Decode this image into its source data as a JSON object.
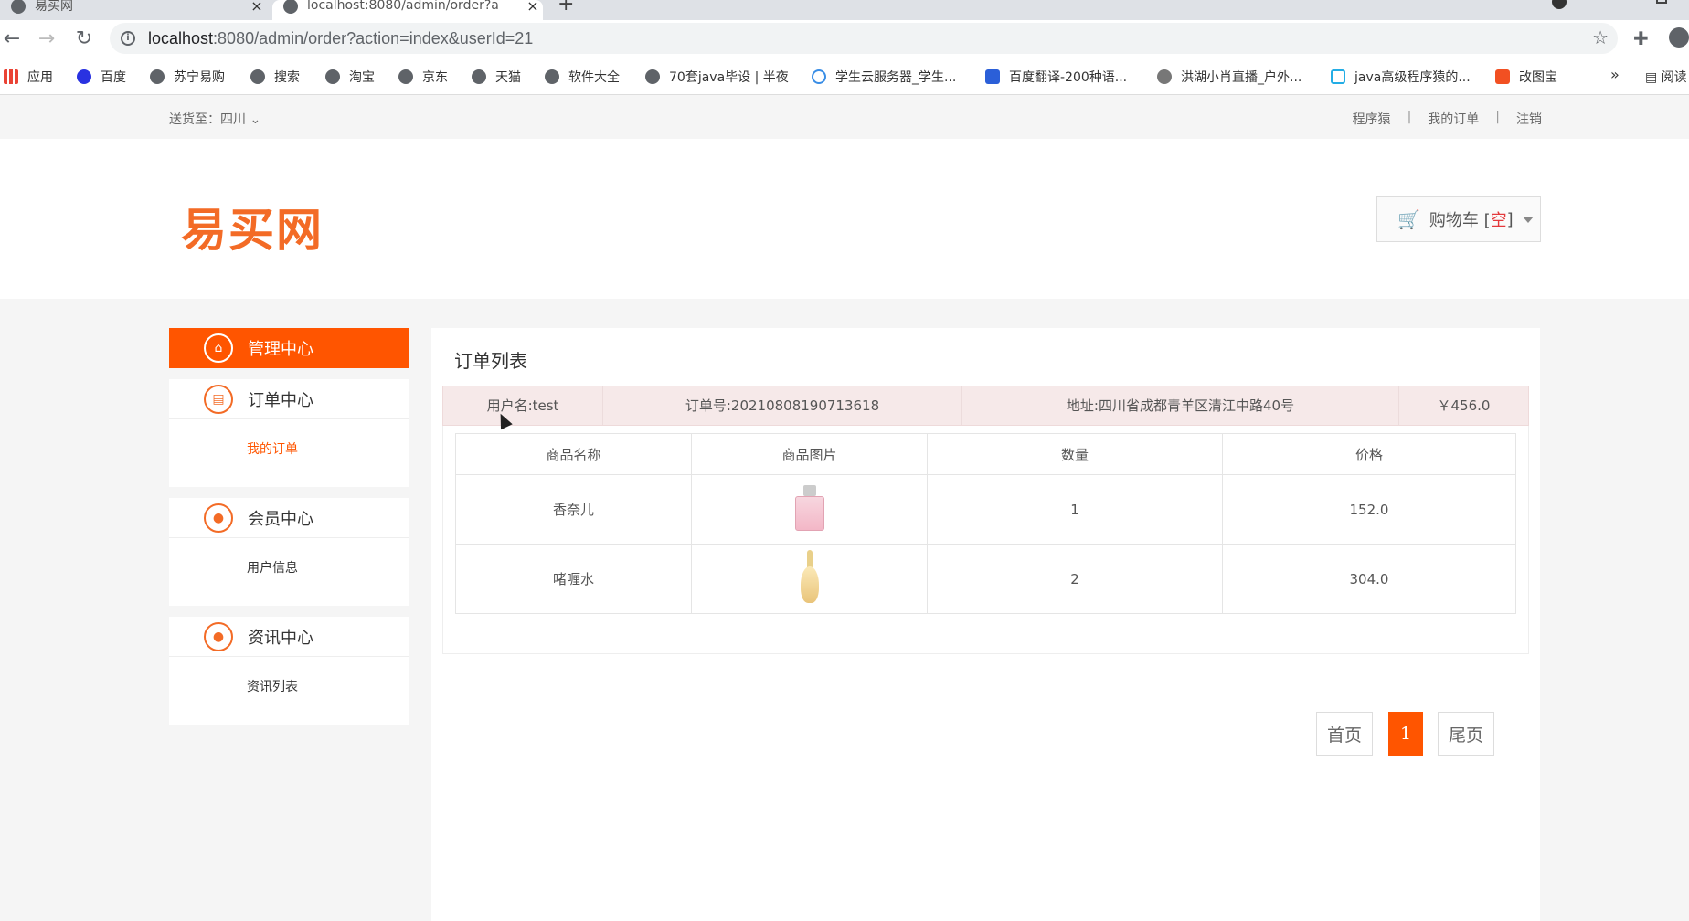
{
  "browser": {
    "tabs": [
      {
        "title": "易买网",
        "active": false
      },
      {
        "title": "localhost:8080/admin/order?a",
        "active": true
      }
    ],
    "url_host": "localhost",
    "url_rest": ":8080/admin/order?action=index&userId=21",
    "bookmarks": [
      {
        "label": "应用",
        "icon": "apps-grid-icon"
      },
      {
        "label": "百度",
        "icon": "baidu-icon"
      },
      {
        "label": "苏宁易购",
        "icon": "globe-icon"
      },
      {
        "label": "搜索",
        "icon": "globe-icon"
      },
      {
        "label": "淘宝",
        "icon": "globe-icon"
      },
      {
        "label": "京东",
        "icon": "globe-icon"
      },
      {
        "label": "天猫",
        "icon": "globe-icon"
      },
      {
        "label": "软件大全",
        "icon": "globe-icon"
      },
      {
        "label": "70套java毕设 | 半夜",
        "icon": "globe-icon"
      },
      {
        "label": "学生云服务器_学生...",
        "icon": "cloud-icon"
      },
      {
        "label": "百度翻译-200种语...",
        "icon": "translate-icon"
      },
      {
        "label": "洪湖小肖直播_户外...",
        "icon": "bird-icon"
      },
      {
        "label": "java高级程序猿的...",
        "icon": "bilibili-icon"
      },
      {
        "label": "改图宝",
        "icon": "orange-square-icon"
      }
    ],
    "more_label": "»",
    "reader_label": "阅读"
  },
  "topbar": {
    "ship_to": "送货至：四川",
    "links": [
      "程序猿",
      "我的订单",
      "注销"
    ]
  },
  "header": {
    "logo": "易买网",
    "cart_label": "购物车 [",
    "cart_state": "空",
    "cart_close": "]"
  },
  "sidebar": {
    "main": "管理中心",
    "sections": [
      {
        "title": "订单中心",
        "items": [
          "我的订单"
        ]
      },
      {
        "title": "会员中心",
        "items": [
          "用户信息"
        ]
      },
      {
        "title": "资讯中心",
        "items": [
          "资讯列表"
        ]
      }
    ]
  },
  "main": {
    "title": "订单列表",
    "order": {
      "user": "用户名:test",
      "order_no": "订单号:20210808190713618",
      "address": "地址:四川省成都青羊区清江中路40号",
      "total": "￥456.0"
    },
    "columns": [
      "商品名称",
      "商品图片",
      "数量",
      "价格"
    ],
    "rows": [
      {
        "name": "香奈儿",
        "image": "pink-perfume-bottle",
        "qty": "1",
        "price": "152.0"
      },
      {
        "name": "啫喱水",
        "image": "gold-perfume-bottle",
        "qty": "2",
        "price": "304.0"
      }
    ],
    "pager": {
      "first": "首页",
      "current": "1",
      "last": "尾页"
    }
  }
}
